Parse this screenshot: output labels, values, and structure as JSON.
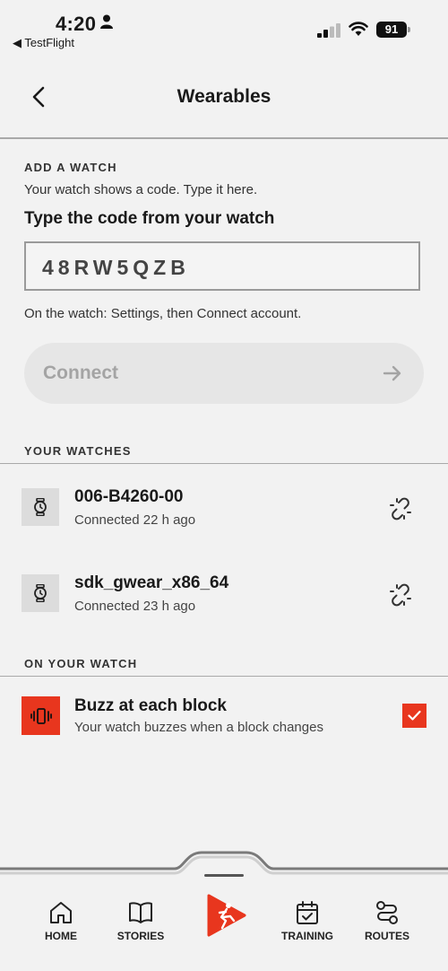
{
  "status_bar": {
    "time": "4:20",
    "back_app": "◀ TestFlight",
    "battery": "91"
  },
  "header": {
    "title": "Wearables"
  },
  "add_watch": {
    "section_label": "ADD A WATCH",
    "hint": "Your watch shows a code. Type it here.",
    "heading": "Type the code from your watch",
    "code_value": "48RW5QZB",
    "help": "On the watch: Settings, then Connect account.",
    "connect_label": "Connect"
  },
  "your_watches": {
    "section_label": "YOUR WATCHES",
    "items": [
      {
        "name": "006-B4260-00",
        "status": "Connected 22 h ago"
      },
      {
        "name": "sdk_gwear_x86_64",
        "status": "Connected 23 h ago"
      }
    ]
  },
  "on_your_watch": {
    "section_label": "ON YOUR WATCH",
    "buzz_title": "Buzz at each block",
    "buzz_desc": "Your watch buzzes when a block changes",
    "buzz_checked": true
  },
  "tabbar": {
    "items": [
      {
        "label": "HOME",
        "icon": "home-icon"
      },
      {
        "label": "STORIES",
        "icon": "book-icon"
      },
      {
        "label": "",
        "icon": "play-runner-icon"
      },
      {
        "label": "TRAINING",
        "icon": "calendar-check-icon"
      },
      {
        "label": "ROUTES",
        "icon": "route-icon"
      }
    ]
  },
  "colors": {
    "accent": "#e8361e",
    "background": "#f2f2f2"
  }
}
